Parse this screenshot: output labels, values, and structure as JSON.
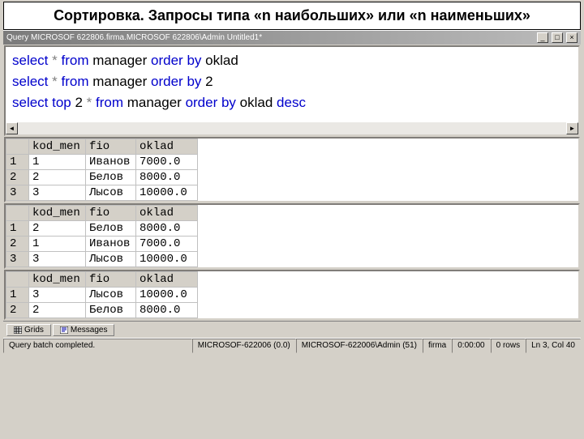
{
  "slide": {
    "title": "Сортировка. Запросы типа «n наибольших»  или «n наименьших»"
  },
  "titlebar": {
    "prefix": "Query   MICROSOF 622806.firma.MICROSOF 622806\\Admin   Untitled1*",
    "min": "_",
    "max": "□",
    "close": "×"
  },
  "sql": {
    "tokens": [
      [
        [
          "kw",
          "select"
        ],
        [
          "op",
          " * "
        ],
        [
          "kw",
          "from"
        ],
        [
          "txt",
          " manager "
        ],
        [
          "kw",
          "order by"
        ],
        [
          "txt",
          " oklad"
        ]
      ],
      [
        [
          "kw",
          "select"
        ],
        [
          "op",
          " * "
        ],
        [
          "kw",
          "from"
        ],
        [
          "txt",
          " manager "
        ],
        [
          "kw",
          "order by"
        ],
        [
          "txt",
          " 2"
        ]
      ],
      [
        [
          "kw",
          "select top"
        ],
        [
          "txt",
          " 2 "
        ],
        [
          "op",
          "* "
        ],
        [
          "kw",
          "from"
        ],
        [
          "txt",
          " manager "
        ],
        [
          "kw",
          "order by"
        ],
        [
          "txt",
          " oklad "
        ],
        [
          "kw",
          "desc"
        ]
      ]
    ]
  },
  "results": [
    {
      "headers": [
        "",
        "kod_men",
        "fio",
        "oklad"
      ],
      "rows": [
        [
          "1",
          "1",
          "Иванов",
          "7000.0"
        ],
        [
          "2",
          "2",
          "Белов",
          "8000.0"
        ],
        [
          "3",
          "3",
          "Лысов",
          "10000.0"
        ]
      ]
    },
    {
      "headers": [
        "",
        "kod_men",
        "fio",
        "oklad"
      ],
      "rows": [
        [
          "1",
          "2",
          "Белов",
          "8000.0"
        ],
        [
          "2",
          "1",
          "Иванов",
          "7000.0"
        ],
        [
          "3",
          "3",
          "Лысов",
          "10000.0"
        ]
      ]
    },
    {
      "headers": [
        "",
        "kod_men",
        "fio",
        "oklad"
      ],
      "rows": [
        [
          "1",
          "3",
          "Лысов",
          "10000.0"
        ],
        [
          "2",
          "2",
          "Белов",
          "8000.0"
        ]
      ]
    }
  ],
  "tabs": {
    "grids": "Grids",
    "messages": "Messages"
  },
  "status": {
    "msg": "Query batch completed.",
    "server": "MICROSOF-622006 (0.0)",
    "user": "MICROSOF-622006\\Admin (51)",
    "db": "firma",
    "time": "0:00:00",
    "rows": "0 rows",
    "pos": "Ln 3, Col 40"
  }
}
